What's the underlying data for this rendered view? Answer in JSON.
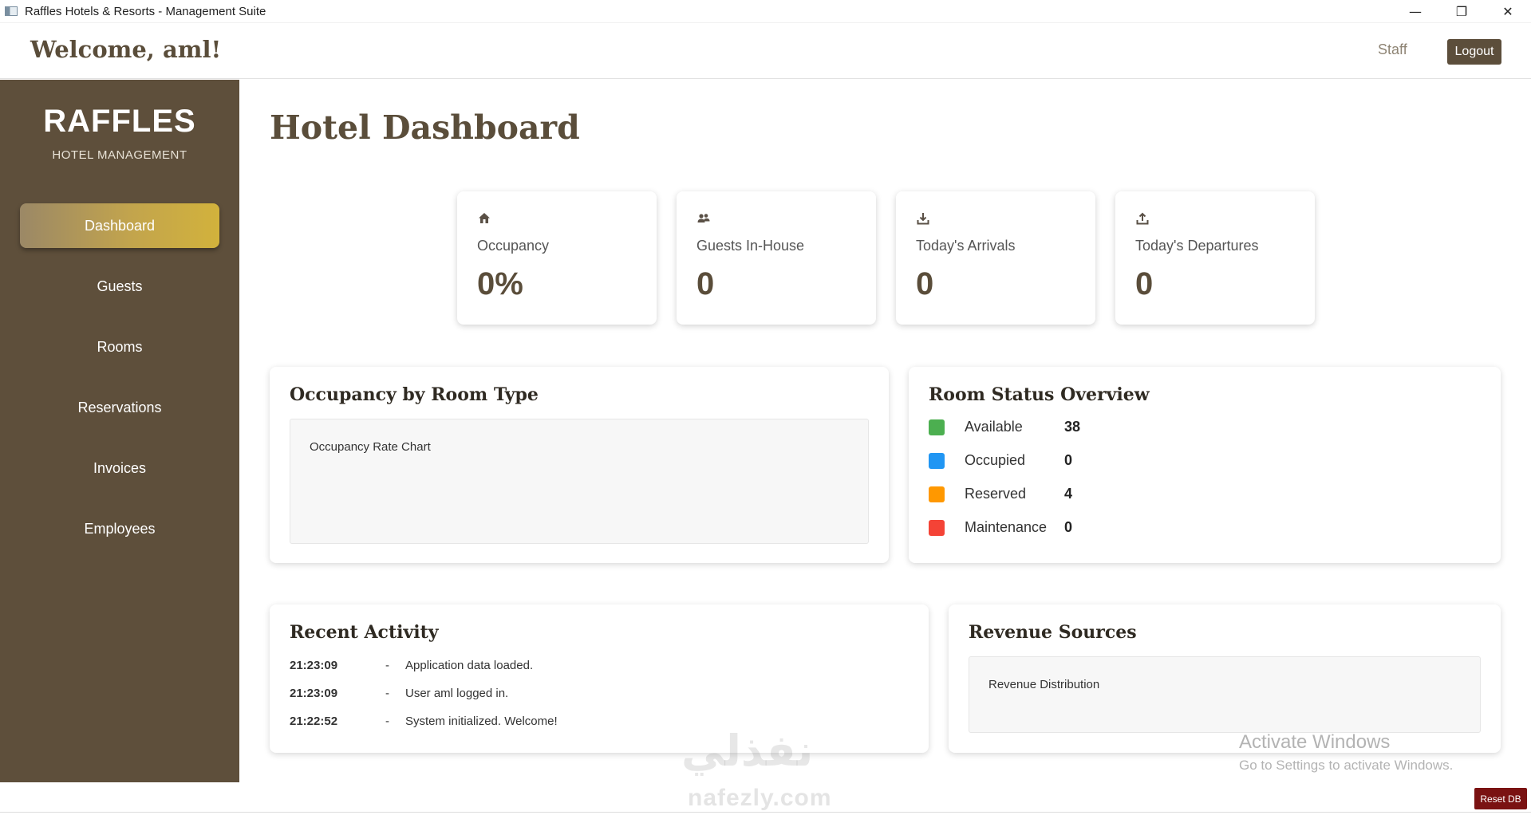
{
  "window": {
    "title": "Raffles Hotels & Resorts - Management Suite",
    "minimize": "—",
    "restore": "❐",
    "close": "✕"
  },
  "header": {
    "welcome": "Welcome, aml!",
    "role": "Staff",
    "logout_label": "Logout"
  },
  "sidebar": {
    "brand": "RAFFLES",
    "brand_sub": "HOTEL MANAGEMENT",
    "items": [
      {
        "label": "Dashboard",
        "active": true
      },
      {
        "label": "Guests"
      },
      {
        "label": "Rooms"
      },
      {
        "label": "Reservations"
      },
      {
        "label": "Invoices"
      },
      {
        "label": "Employees"
      }
    ]
  },
  "main": {
    "title": "Hotel Dashboard",
    "stats": [
      {
        "icon": "home-icon",
        "label": "Occupancy",
        "value": "0%"
      },
      {
        "icon": "users-icon",
        "label": "Guests In-House",
        "value": "0"
      },
      {
        "icon": "download-icon",
        "label": "Today's Arrivals",
        "value": "0"
      },
      {
        "icon": "upload-icon",
        "label": "Today's Departures",
        "value": "0"
      }
    ],
    "occupancy_panel": {
      "title": "Occupancy by Room Type",
      "placeholder": "Occupancy Rate Chart"
    },
    "room_status": {
      "title": "Room Status Overview",
      "items": [
        {
          "label": "Available",
          "count": "38",
          "color": "#4caf50"
        },
        {
          "label": "Occupied",
          "count": "0",
          "color": "#2196f3"
        },
        {
          "label": "Reserved",
          "count": "4",
          "color": "#ff9800"
        },
        {
          "label": "Maintenance",
          "count": "0",
          "color": "#f44336"
        }
      ]
    },
    "recent_activity": {
      "title": "Recent Activity",
      "items": [
        {
          "time": "21:23:09",
          "sep": "-",
          "message": "Application data loaded."
        },
        {
          "time": "21:23:09",
          "sep": "-",
          "message": "User aml logged in."
        },
        {
          "time": "21:22:52",
          "sep": "-",
          "message": "System initialized. Welcome!"
        }
      ]
    },
    "revenue": {
      "title": "Revenue Sources",
      "placeholder": "Revenue Distribution"
    }
  },
  "overlay": {
    "activate_title": "Activate Windows",
    "activate_sub": "Go to Settings to activate Windows.",
    "watermark_logo": "نفذلي",
    "watermark_url": "nafezly.com"
  },
  "footer": {
    "reset_label": "Reset DB"
  }
}
